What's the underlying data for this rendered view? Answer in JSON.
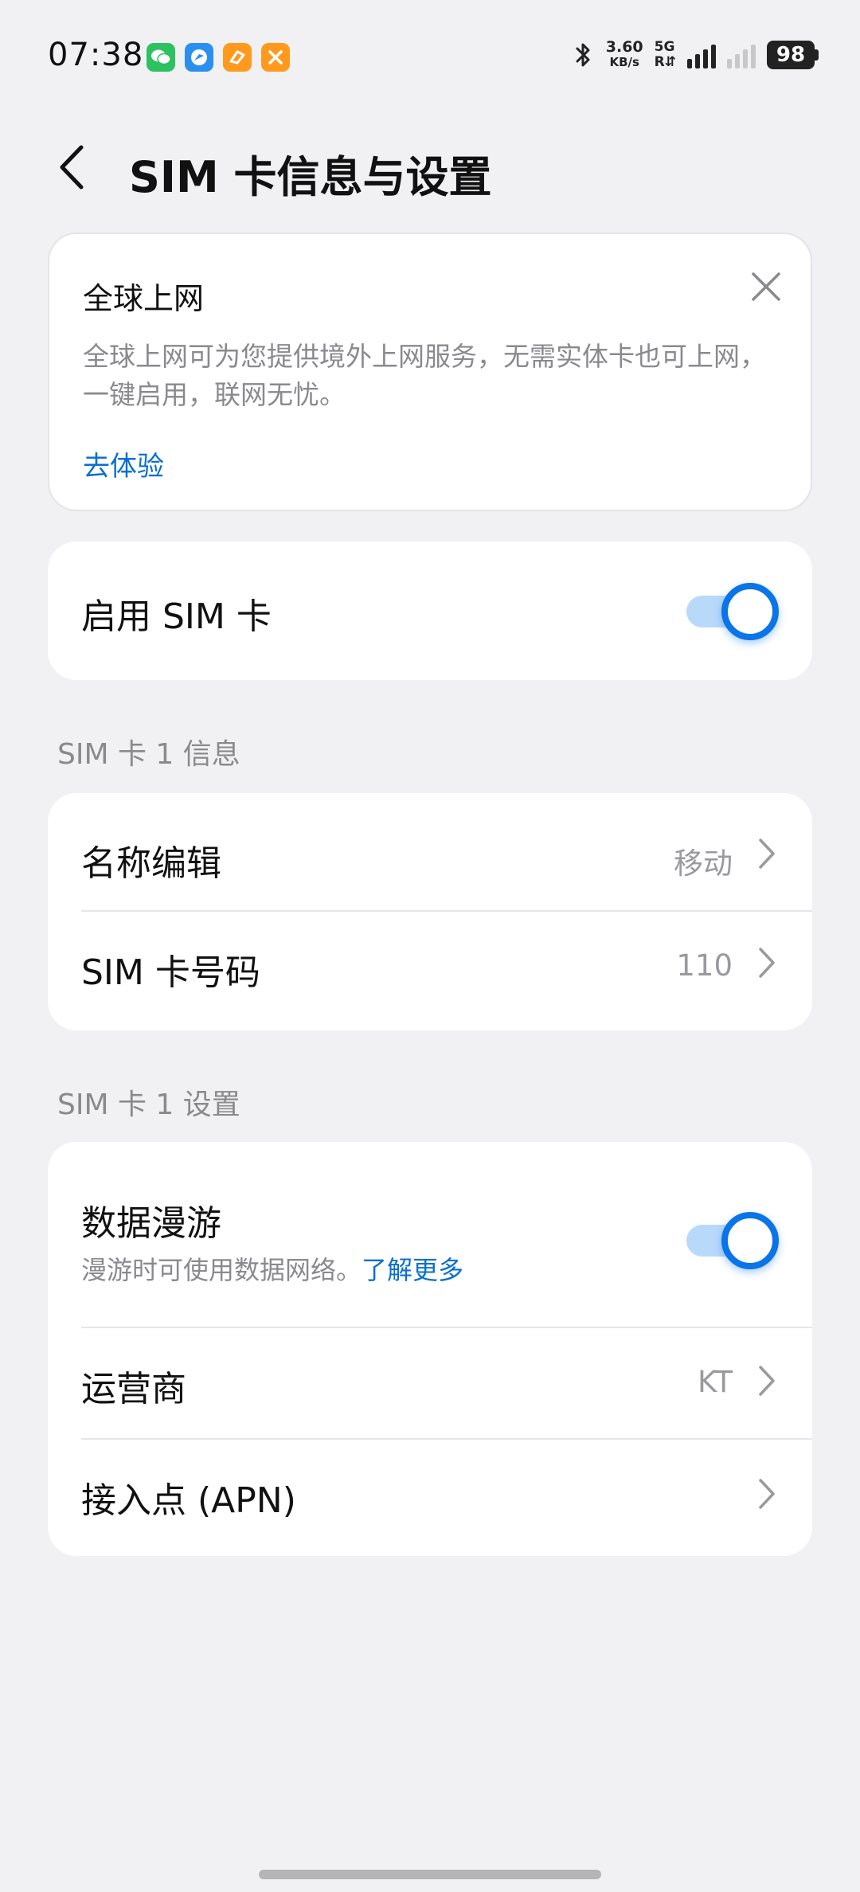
{
  "status_bar": {
    "time": "07:38",
    "app_icons": [
      {
        "name": "wechat-icon",
        "color": "#2dc160",
        "glyph": "◐"
      },
      {
        "name": "browser-icon",
        "color": "#2b8ff0",
        "glyph": "◉"
      },
      {
        "name": "app-orange-icon",
        "color": "#ff9a1f",
        "glyph": "✎"
      },
      {
        "name": "tools-icon",
        "color": "#ff9a1f",
        "glyph": "✕"
      }
    ],
    "net_speed_value": "3.60",
    "net_speed_unit": "KB/s",
    "network_type": "5G",
    "network_sub": "R",
    "battery": "98"
  },
  "header": {
    "title": "SIM 卡信息与设置"
  },
  "promo": {
    "title": "全球上网",
    "description": "全球上网可为您提供境外上网服务，无需实体卡也可上网，一键启用，联网无忧。",
    "link": "去体验"
  },
  "enable_sim": {
    "label": "启用 SIM 卡",
    "enabled": true
  },
  "sim_info": {
    "section_title": "SIM 卡 1 信息",
    "rows": [
      {
        "label": "名称编辑",
        "value": "移动"
      },
      {
        "label": "SIM 卡号码",
        "value": "110"
      }
    ]
  },
  "sim_settings": {
    "section_title": "SIM 卡 1 设置",
    "roaming": {
      "label": "数据漫游",
      "subtitle": "漫游时可使用数据网络。",
      "link": "了解更多",
      "enabled": true
    },
    "rows": [
      {
        "label": "运营商",
        "value": "KT"
      },
      {
        "label": "接入点 (APN)",
        "value": ""
      }
    ]
  },
  "colors": {
    "accent": "#0a74e8",
    "link": "#0a6fd0",
    "background": "#f1f1f3",
    "switch_track": "#b9d9fb"
  }
}
